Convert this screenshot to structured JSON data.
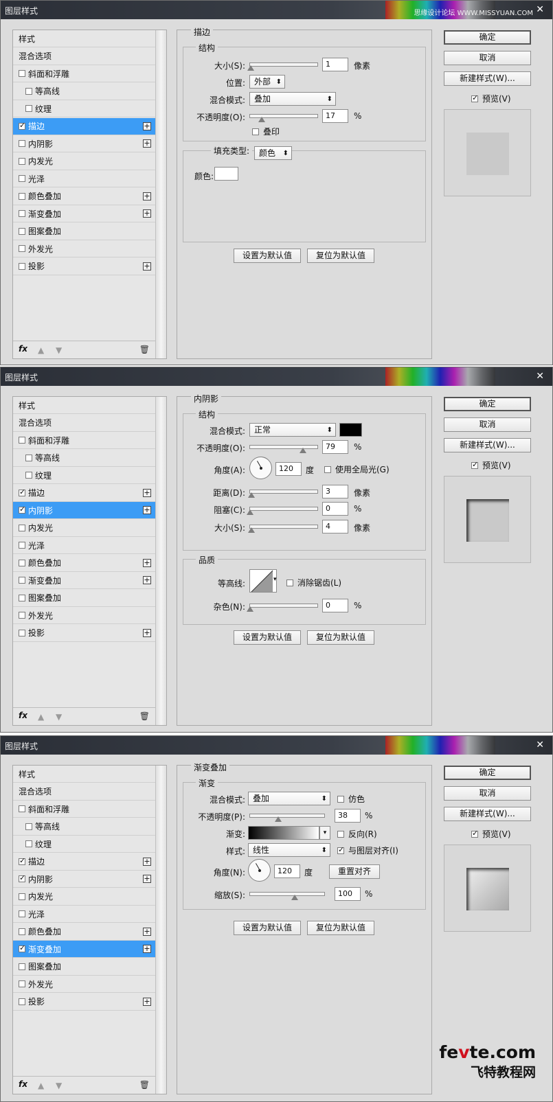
{
  "window_title": "图层样式",
  "watermark_top": "思缘设计论坛 WWW.MISSYUAN.COM",
  "watermark_bottom": {
    "line1_a": "fe",
    "line1_b": "v",
    "line1_c": "te.com",
    "line2": "飞特教程网"
  },
  "common": {
    "ok_button": "确定",
    "cancel_button": "取消",
    "new_style_button": "新建样式(W)...",
    "preview_label": "预览(V)",
    "make_default_button": "设置为默认值",
    "reset_default_button": "复位为默认值",
    "fx_label": "fx"
  },
  "sidebar_items": [
    "样式",
    "混合选项",
    "斜面和浮雕",
    "等高线",
    "纹理",
    "描边",
    "内阴影",
    "内发光",
    "光泽",
    "颜色叠加",
    "渐变叠加",
    "图案叠加",
    "外发光",
    "投影"
  ],
  "dialog1": {
    "panel_title": "描边",
    "structure_title": "结构",
    "size_label": "大小(S):",
    "size_value": "1",
    "size_unit": "像素",
    "position_label": "位置:",
    "position_value": "外部",
    "blend_label": "混合模式:",
    "blend_value": "叠加",
    "opacity_label": "不透明度(O):",
    "opacity_value": "17",
    "opacity_unit": "%",
    "overprint_label": "叠印",
    "fill_type_label": "填充类型:",
    "fill_type_value": "颜色",
    "color_label": "颜色:",
    "checked": [
      false,
      false,
      false,
      false,
      false,
      true,
      false,
      false,
      false,
      false,
      false,
      false,
      false,
      false
    ],
    "active_index": 5
  },
  "dialog2": {
    "panel_title": "内阴影",
    "structure_title": "结构",
    "blend_label": "混合模式:",
    "blend_value": "正常",
    "opacity_label": "不透明度(O):",
    "opacity_value": "79",
    "opacity_unit": "%",
    "angle_label": "角度(A):",
    "angle_value": "120",
    "angle_unit": "度",
    "global_light_label": "使用全局光(G)",
    "distance_label": "距离(D):",
    "distance_value": "3",
    "distance_unit": "像素",
    "choke_label": "阻塞(C):",
    "choke_value": "0",
    "choke_unit": "%",
    "size_label": "大小(S):",
    "size_value": "4",
    "size_unit": "像素",
    "quality_title": "品质",
    "contour_label": "等高线:",
    "antialias_label": "消除锯齿(L)",
    "noise_label": "杂色(N):",
    "noise_value": "0",
    "noise_unit": "%",
    "checked": [
      false,
      false,
      false,
      false,
      false,
      true,
      true,
      false,
      false,
      false,
      false,
      false,
      false,
      false
    ],
    "active_index": 6
  },
  "dialog3": {
    "panel_title": "渐变叠加",
    "gradient_title": "渐变",
    "blend_label": "混合模式:",
    "blend_value": "叠加",
    "dither_label": "仿色",
    "opacity_label": "不透明度(P):",
    "opacity_value": "38",
    "opacity_unit": "%",
    "gradient_label": "渐变:",
    "reverse_label": "反向(R)",
    "style_label": "样式:",
    "style_value": "线性",
    "align_label": "与图层对齐(I)",
    "angle_label": "角度(N):",
    "angle_value": "120",
    "angle_unit": "度",
    "reset_align_button": "重置对齐",
    "scale_label": "缩放(S):",
    "scale_value": "100",
    "scale_unit": "%",
    "checked": [
      false,
      false,
      false,
      false,
      false,
      true,
      true,
      false,
      false,
      false,
      true,
      false,
      false,
      false
    ],
    "active_index": 10
  },
  "colors": {
    "active_item": "#3c9cf5",
    "dialog_bg": "#dcdcdc",
    "shadow_color": "#000000",
    "stroke_color": "#ffffff"
  }
}
